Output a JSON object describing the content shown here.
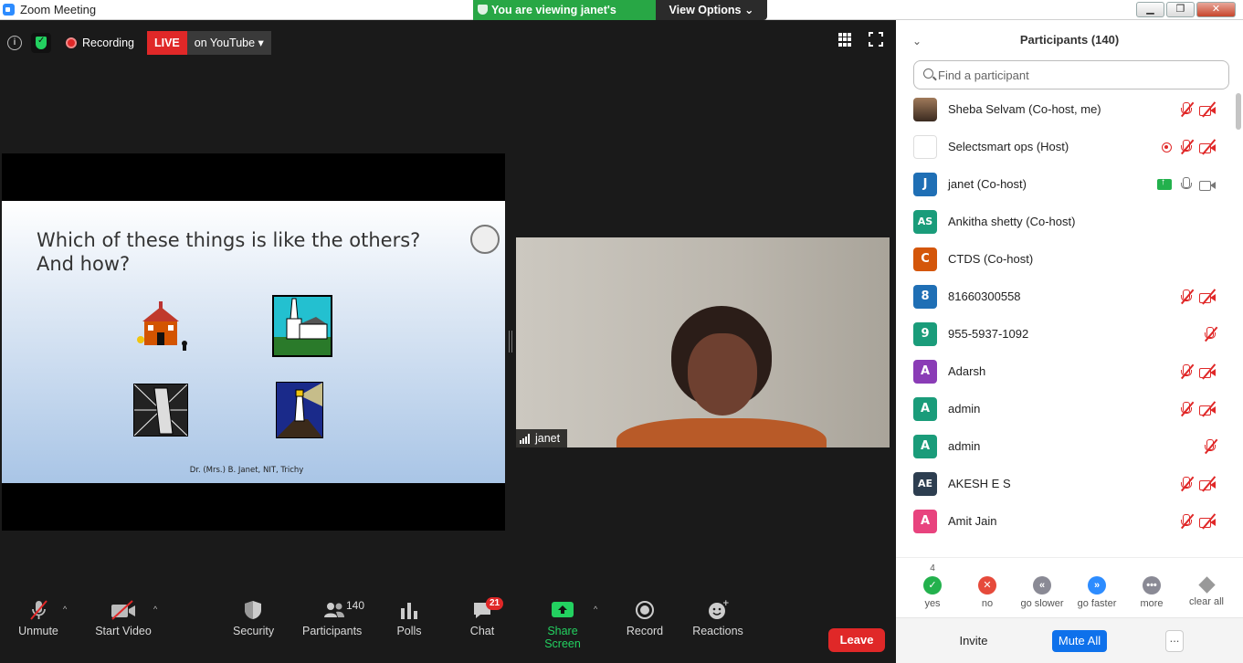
{
  "window": {
    "title": "Zoom Meeting",
    "minimize": "▁",
    "restore": "❐",
    "close": "✕"
  },
  "banner": {
    "viewing": "You are viewing janet's screen",
    "view_options": "View Options"
  },
  "topbar": {
    "recording": "Recording",
    "live": "LIVE",
    "live_platform": "on YouTube"
  },
  "slide": {
    "title_line1": "Which of these things is like the others?",
    "title_line2": "And how?",
    "footer": "Dr. (Mrs.) B. Janet, NIT, Trichy"
  },
  "video": {
    "name": "janet"
  },
  "toolbar": {
    "unmute": "Unmute",
    "start_video": "Start Video",
    "security": "Security",
    "participants": "Participants",
    "participants_count": "140",
    "polls": "Polls",
    "chat": "Chat",
    "chat_badge": "21",
    "share_screen": "Share Screen",
    "record": "Record",
    "reactions": "Reactions",
    "leave": "Leave"
  },
  "panel": {
    "title": "Participants (140)",
    "search_placeholder": "Find a participant",
    "participants": [
      {
        "name": "Sheba Selvam (Co-host, me)",
        "avatar": "",
        "color": "#8a6a4a",
        "icons": [
          "mic-off",
          "cam-off"
        ]
      },
      {
        "name": "Selectsmart ops (Host)",
        "avatar": "",
        "color": "#ffffff",
        "icons": [
          "rec",
          "mic-off",
          "cam-off"
        ]
      },
      {
        "name": "janet (Co-host)",
        "avatar": "J",
        "color": "#1f6fb5",
        "icons": [
          "share",
          "mic",
          "cam"
        ]
      },
      {
        "name": "Ankitha shetty (Co-host)",
        "avatar": "AS",
        "color": "#1a9c7a",
        "icons": []
      },
      {
        "name": "CTDS (Co-host)",
        "avatar": "C",
        "color": "#d4560a",
        "icons": []
      },
      {
        "name": "81660300558",
        "avatar": "8",
        "color": "#1f6fb5",
        "icons": [
          "mic-off",
          "cam-off"
        ]
      },
      {
        "name": "955-5937-1092",
        "avatar": "9",
        "color": "#1a9c7a",
        "icons": [
          "mic-off"
        ]
      },
      {
        "name": "Adarsh",
        "avatar": "A",
        "color": "#8a3cb6",
        "icons": [
          "mic-off",
          "cam-off"
        ]
      },
      {
        "name": "admin",
        "avatar": "A",
        "color": "#1a9c7a",
        "icons": [
          "mic-off",
          "cam-off"
        ]
      },
      {
        "name": "admin",
        "avatar": "A",
        "color": "#1a9c7a",
        "icons": [
          "mic-off"
        ]
      },
      {
        "name": "AKESH E S",
        "avatar": "AE",
        "color": "#2d3e50",
        "icons": [
          "mic-off",
          "cam-off"
        ]
      },
      {
        "name": "Amit Jain",
        "avatar": "A",
        "color": "#e8437e",
        "icons": [
          "mic-off",
          "cam-off"
        ]
      }
    ],
    "reactions": [
      {
        "label": "yes",
        "count": "4",
        "color": "#23b14d",
        "glyph": "✓"
      },
      {
        "label": "no",
        "count": "",
        "color": "#e64a3b",
        "glyph": "✕"
      },
      {
        "label": "go slower",
        "count": "",
        "color": "#8a8a95",
        "glyph": "«"
      },
      {
        "label": "go faster",
        "count": "",
        "color": "#2d8cff",
        "glyph": "»"
      },
      {
        "label": "more",
        "count": "",
        "color": "#8a8a95",
        "glyph": "•••"
      },
      {
        "label": "clear all",
        "count": "",
        "color": "",
        "glyph": ""
      }
    ],
    "invite": "Invite",
    "mute_all": "Mute All",
    "more": "..."
  }
}
